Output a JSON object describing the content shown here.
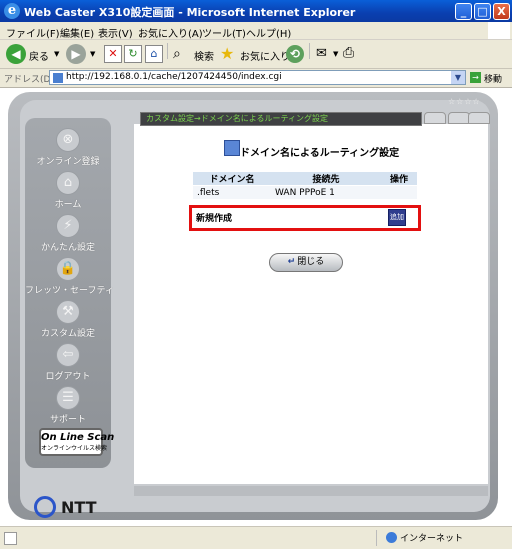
{
  "window": {
    "title": "Web Caster X310設定画面 - Microsoft Internet Explorer",
    "min": "_",
    "max": "□",
    "close": "X"
  },
  "menu": [
    "ファイル(F)",
    "編集(E)",
    "表示(V)",
    "お気に入り(A)",
    "ツール(T)",
    "ヘルプ(H)"
  ],
  "toolbar": {
    "back": "戻る",
    "search": "検索",
    "favorites": "お気に入り"
  },
  "address": {
    "label": "アドレス(D)",
    "url": "http://192.168.0.1/cache/1207424450/index.cgi",
    "go": "移動"
  },
  "sidebar": {
    "items": [
      {
        "label": "オンライン登録",
        "icon": "⊗"
      },
      {
        "label": "ホーム",
        "icon": "⌂"
      },
      {
        "label": "かんたん設定",
        "icon": "⚡"
      },
      {
        "label": "フレッツ・セーフティ",
        "icon": "🔒"
      },
      {
        "label": "カスタム設定",
        "icon": "⚒"
      },
      {
        "label": "ログアウト",
        "icon": "⇦"
      },
      {
        "label": "サポート",
        "icon": "☰"
      }
    ],
    "scan": {
      "title": "On Line Scan",
      "subtitle": "オンラインウイルス検索"
    },
    "brand": "NTT"
  },
  "main": {
    "breadcrumb": "カスタム設定→ドメイン名によるルーティング設定",
    "heading": "ドメイン名によるルーティング設定",
    "table": {
      "headers": [
        "ドメイン名",
        "接続先",
        "操作"
      ],
      "rows": [
        {
          "domain": ".flets",
          "dest": "WAN PPPoE 1",
          "op": ""
        }
      ],
      "new_row_label": "新規作成",
      "add_button": "追加"
    },
    "close_button": "閉じる"
  },
  "status": {
    "zone": "インターネット"
  },
  "stars": "☆☆☆☆"
}
